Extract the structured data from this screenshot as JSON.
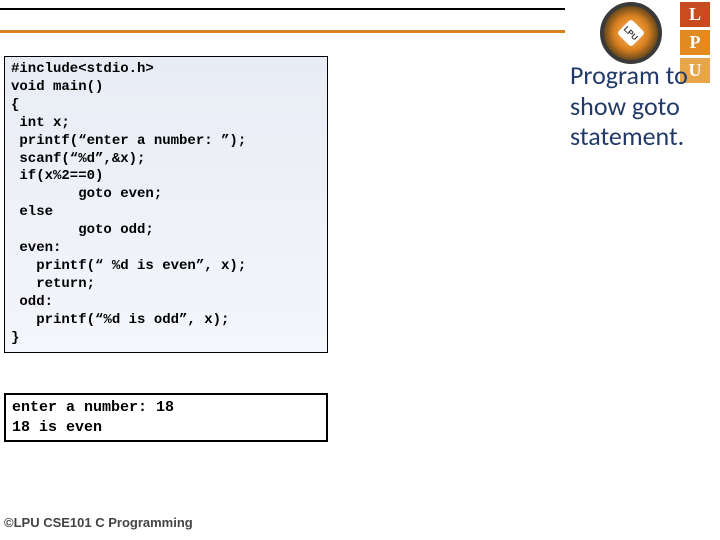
{
  "logo": {
    "monogram": "LPU",
    "side": [
      "L",
      "P",
      "U"
    ]
  },
  "code": {
    "lines": [
      "#include<stdio.h>",
      "void main()",
      "{",
      " int x;",
      " printf(“enter a number: ”);",
      " scanf(“%d”,&x);",
      " if(x%2==0)",
      "        goto even;",
      " else",
      "        goto odd;",
      " even:",
      "   printf(“ %d is even”, x);",
      "   return;",
      " odd:",
      "   printf(“%d is odd”, x);",
      "}"
    ]
  },
  "output": {
    "lines": [
      "enter a number: 18",
      "18 is even"
    ]
  },
  "description": "Program to show goto statement.",
  "footer": "©LPU CSE101 C Programming"
}
